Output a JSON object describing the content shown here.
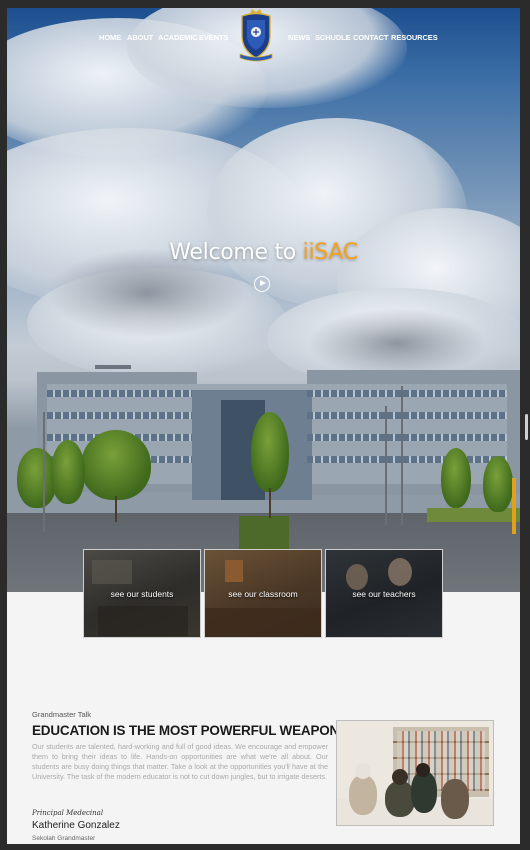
{
  "nav": {
    "left": [
      "HOME",
      "ABOUT",
      "ACADEMIC",
      "EVENTS"
    ],
    "right": [
      "NEWS",
      "SCHUDLE",
      "CONTACT",
      "RESOURCES"
    ]
  },
  "hero": {
    "welcome_prefix": "Welcome to ",
    "welcome_accent": "iiSAC",
    "accent_color": "#f4a020"
  },
  "cards": [
    {
      "label": "see our students"
    },
    {
      "label": "see our classroom"
    },
    {
      "label": "see our teachers"
    }
  ],
  "talk": {
    "label": "Grandmaster Talk",
    "headline": "EDUCATION IS THE MOST POWERFUL WEAPON",
    "body": "Our students are talented, hard-working and full of good ideas. We encourage and empower them to bring their ideas to life. Hands-on opportunities are what we're all about. Our students are busy doing things that matter. Take a look at the opportunities you'll have at the University. The task of the modern educator is not to cut down jungles, but to irrigate deserts.",
    "signature": "Principal Medecinal",
    "author": "Katherine Gonzalez",
    "role": "Sekolah Grandmaster"
  }
}
